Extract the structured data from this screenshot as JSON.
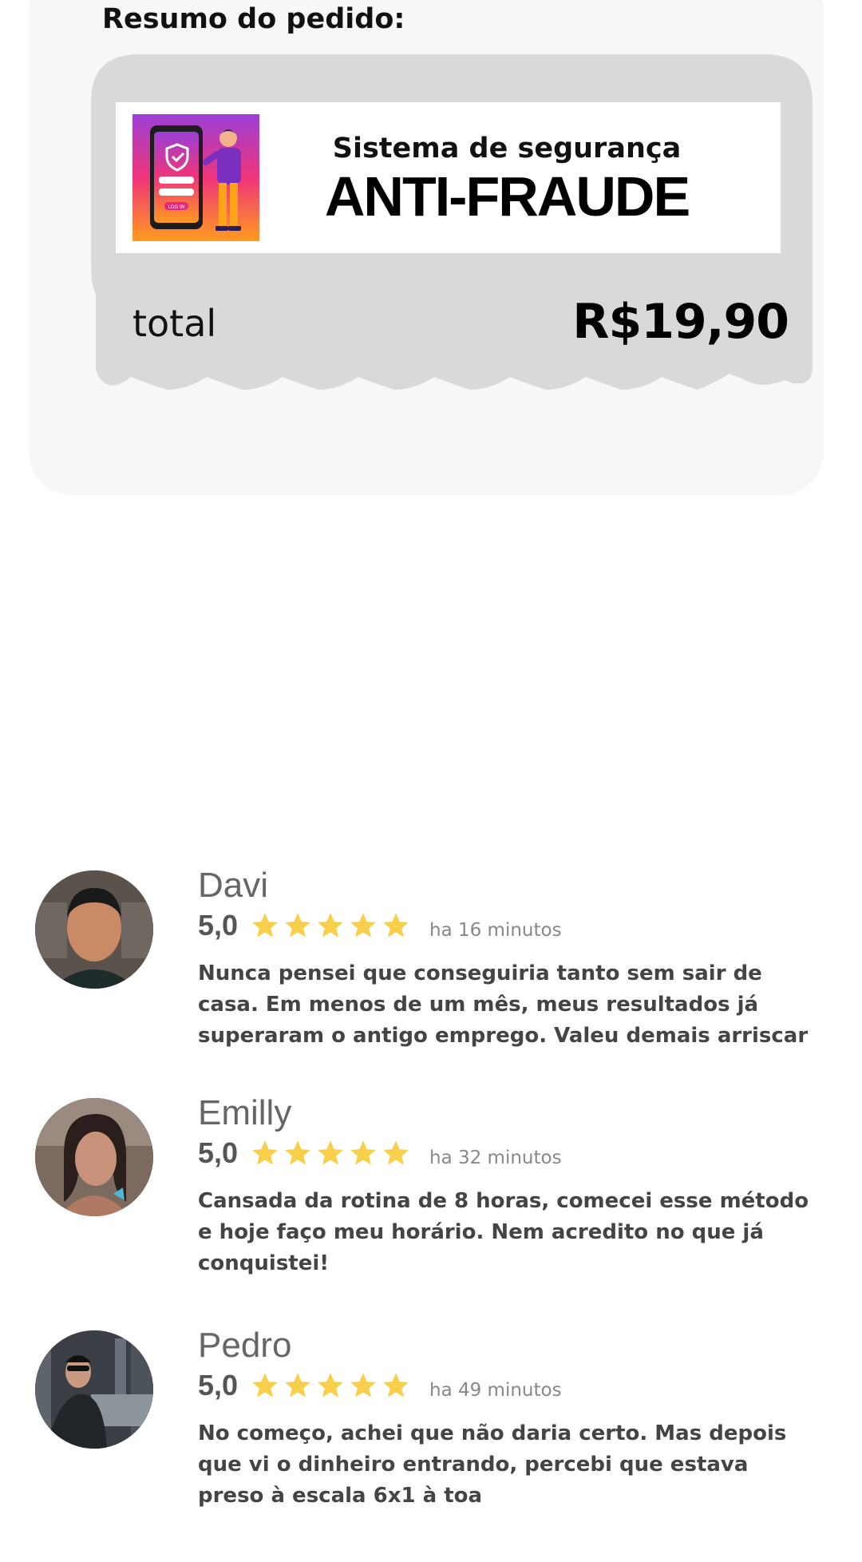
{
  "summary": {
    "title": "Resumo do pedido:",
    "product": {
      "subtitle": "Sistema de segurança",
      "title": "ANTI-FRAUDE",
      "image_icon": "phone-login-illustration",
      "image_login_label": "LOG IN"
    },
    "total_label": "total",
    "total_value": "R$19,90"
  },
  "reviews": [
    {
      "name": "Davi",
      "score": "5,0",
      "stars": 5,
      "time": "ha 16 minutos",
      "text": "Nunca pensei que conseguiria tanto sem sair de casa. Em menos de um mês, meus resultados já superaram o antigo emprego. Valeu demais arriscar"
    },
    {
      "name": "Emilly",
      "score": "5,0",
      "stars": 5,
      "time": "ha 32 minutos",
      "text": "Cansada da rotina de 8 horas, comecei esse método e hoje faço meu horário. Nem acredito no que já conquistei!"
    },
    {
      "name": "Pedro",
      "score": "5,0",
      "stars": 5,
      "time": "ha 49 minutos",
      "text": "No começo, achei que não daria certo. Mas depois que vi o dinheiro entrando, percebi que estava preso à escala 6x1 à toa"
    }
  ],
  "colors": {
    "card_bg": "#f7f7f7",
    "receipt_bg": "#d9d9d9",
    "star": "#f7cf4a",
    "text_gray": "#444444"
  }
}
